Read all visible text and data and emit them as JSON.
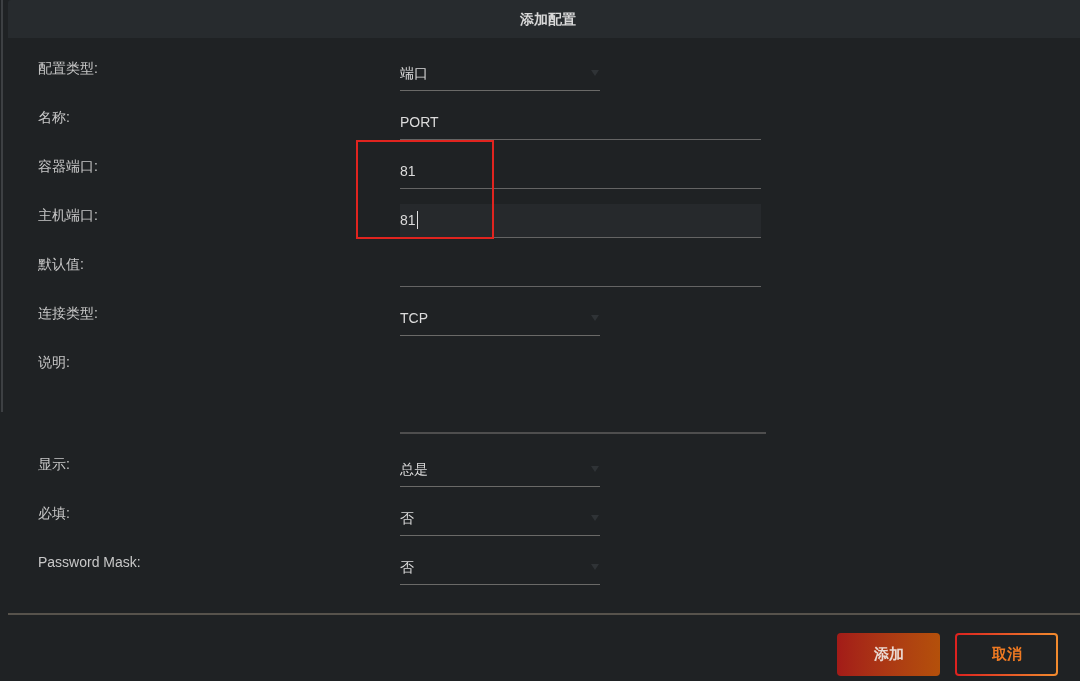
{
  "dialog": {
    "title": "添加配置"
  },
  "fields": [
    {
      "label": "配置类型:",
      "kind": "select",
      "value": "端口",
      "focused": false
    },
    {
      "label": "名称:",
      "kind": "text",
      "value": "PORT",
      "focused": false
    },
    {
      "label": "容器端口:",
      "kind": "text",
      "value": "81",
      "focused": false
    },
    {
      "label": "主机端口:",
      "kind": "text",
      "value": "81",
      "focused": true
    },
    {
      "label": "默认值:",
      "kind": "text",
      "focused": false
    },
    {
      "label": "连接类型:",
      "kind": "select",
      "value": "TCP",
      "focused": false
    },
    {
      "label": "说明:",
      "kind": "textarea",
      "focused": false
    },
    {
      "label": "显示:",
      "kind": "select",
      "value": "总是",
      "focused": false
    },
    {
      "label": "必填:",
      "kind": "select",
      "value": "否",
      "focused": false
    },
    {
      "label": "Password Mask:",
      "kind": "select",
      "value": "否",
      "focused": false
    }
  ],
  "buttons": [
    {
      "label": "添加",
      "kind": "primary"
    },
    {
      "label": "取消",
      "kind": "outline"
    }
  ],
  "annotations": [
    {
      "kind": "frame"
    }
  ]
}
